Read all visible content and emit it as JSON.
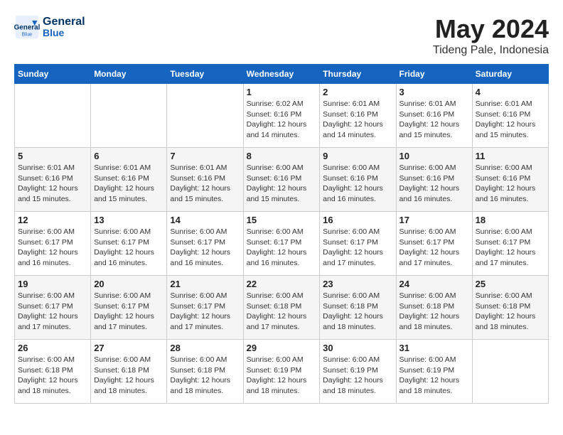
{
  "header": {
    "logo_line1": "General",
    "logo_line2": "Blue",
    "month": "May 2024",
    "location": "Tideng Pale, Indonesia"
  },
  "weekdays": [
    "Sunday",
    "Monday",
    "Tuesday",
    "Wednesday",
    "Thursday",
    "Friday",
    "Saturday"
  ],
  "weeks": [
    [
      {
        "day": "",
        "info": ""
      },
      {
        "day": "",
        "info": ""
      },
      {
        "day": "",
        "info": ""
      },
      {
        "day": "1",
        "info": "Sunrise: 6:02 AM\nSunset: 6:16 PM\nDaylight: 12 hours\nand 14 minutes."
      },
      {
        "day": "2",
        "info": "Sunrise: 6:01 AM\nSunset: 6:16 PM\nDaylight: 12 hours\nand 14 minutes."
      },
      {
        "day": "3",
        "info": "Sunrise: 6:01 AM\nSunset: 6:16 PM\nDaylight: 12 hours\nand 15 minutes."
      },
      {
        "day": "4",
        "info": "Sunrise: 6:01 AM\nSunset: 6:16 PM\nDaylight: 12 hours\nand 15 minutes."
      }
    ],
    [
      {
        "day": "5",
        "info": "Sunrise: 6:01 AM\nSunset: 6:16 PM\nDaylight: 12 hours\nand 15 minutes."
      },
      {
        "day": "6",
        "info": "Sunrise: 6:01 AM\nSunset: 6:16 PM\nDaylight: 12 hours\nand 15 minutes."
      },
      {
        "day": "7",
        "info": "Sunrise: 6:01 AM\nSunset: 6:16 PM\nDaylight: 12 hours\nand 15 minutes."
      },
      {
        "day": "8",
        "info": "Sunrise: 6:00 AM\nSunset: 6:16 PM\nDaylight: 12 hours\nand 15 minutes."
      },
      {
        "day": "9",
        "info": "Sunrise: 6:00 AM\nSunset: 6:16 PM\nDaylight: 12 hours\nand 16 minutes."
      },
      {
        "day": "10",
        "info": "Sunrise: 6:00 AM\nSunset: 6:16 PM\nDaylight: 12 hours\nand 16 minutes."
      },
      {
        "day": "11",
        "info": "Sunrise: 6:00 AM\nSunset: 6:16 PM\nDaylight: 12 hours\nand 16 minutes."
      }
    ],
    [
      {
        "day": "12",
        "info": "Sunrise: 6:00 AM\nSunset: 6:17 PM\nDaylight: 12 hours\nand 16 minutes."
      },
      {
        "day": "13",
        "info": "Sunrise: 6:00 AM\nSunset: 6:17 PM\nDaylight: 12 hours\nand 16 minutes."
      },
      {
        "day": "14",
        "info": "Sunrise: 6:00 AM\nSunset: 6:17 PM\nDaylight: 12 hours\nand 16 minutes."
      },
      {
        "day": "15",
        "info": "Sunrise: 6:00 AM\nSunset: 6:17 PM\nDaylight: 12 hours\nand 16 minutes."
      },
      {
        "day": "16",
        "info": "Sunrise: 6:00 AM\nSunset: 6:17 PM\nDaylight: 12 hours\nand 17 minutes."
      },
      {
        "day": "17",
        "info": "Sunrise: 6:00 AM\nSunset: 6:17 PM\nDaylight: 12 hours\nand 17 minutes."
      },
      {
        "day": "18",
        "info": "Sunrise: 6:00 AM\nSunset: 6:17 PM\nDaylight: 12 hours\nand 17 minutes."
      }
    ],
    [
      {
        "day": "19",
        "info": "Sunrise: 6:00 AM\nSunset: 6:17 PM\nDaylight: 12 hours\nand 17 minutes."
      },
      {
        "day": "20",
        "info": "Sunrise: 6:00 AM\nSunset: 6:17 PM\nDaylight: 12 hours\nand 17 minutes."
      },
      {
        "day": "21",
        "info": "Sunrise: 6:00 AM\nSunset: 6:17 PM\nDaylight: 12 hours\nand 17 minutes."
      },
      {
        "day": "22",
        "info": "Sunrise: 6:00 AM\nSunset: 6:18 PM\nDaylight: 12 hours\nand 17 minutes."
      },
      {
        "day": "23",
        "info": "Sunrise: 6:00 AM\nSunset: 6:18 PM\nDaylight: 12 hours\nand 18 minutes."
      },
      {
        "day": "24",
        "info": "Sunrise: 6:00 AM\nSunset: 6:18 PM\nDaylight: 12 hours\nand 18 minutes."
      },
      {
        "day": "25",
        "info": "Sunrise: 6:00 AM\nSunset: 6:18 PM\nDaylight: 12 hours\nand 18 minutes."
      }
    ],
    [
      {
        "day": "26",
        "info": "Sunrise: 6:00 AM\nSunset: 6:18 PM\nDaylight: 12 hours\nand 18 minutes."
      },
      {
        "day": "27",
        "info": "Sunrise: 6:00 AM\nSunset: 6:18 PM\nDaylight: 12 hours\nand 18 minutes."
      },
      {
        "day": "28",
        "info": "Sunrise: 6:00 AM\nSunset: 6:18 PM\nDaylight: 12 hours\nand 18 minutes."
      },
      {
        "day": "29",
        "info": "Sunrise: 6:00 AM\nSunset: 6:19 PM\nDaylight: 12 hours\nand 18 minutes."
      },
      {
        "day": "30",
        "info": "Sunrise: 6:00 AM\nSunset: 6:19 PM\nDaylight: 12 hours\nand 18 minutes."
      },
      {
        "day": "31",
        "info": "Sunrise: 6:00 AM\nSunset: 6:19 PM\nDaylight: 12 hours\nand 18 minutes."
      },
      {
        "day": "",
        "info": ""
      }
    ]
  ]
}
